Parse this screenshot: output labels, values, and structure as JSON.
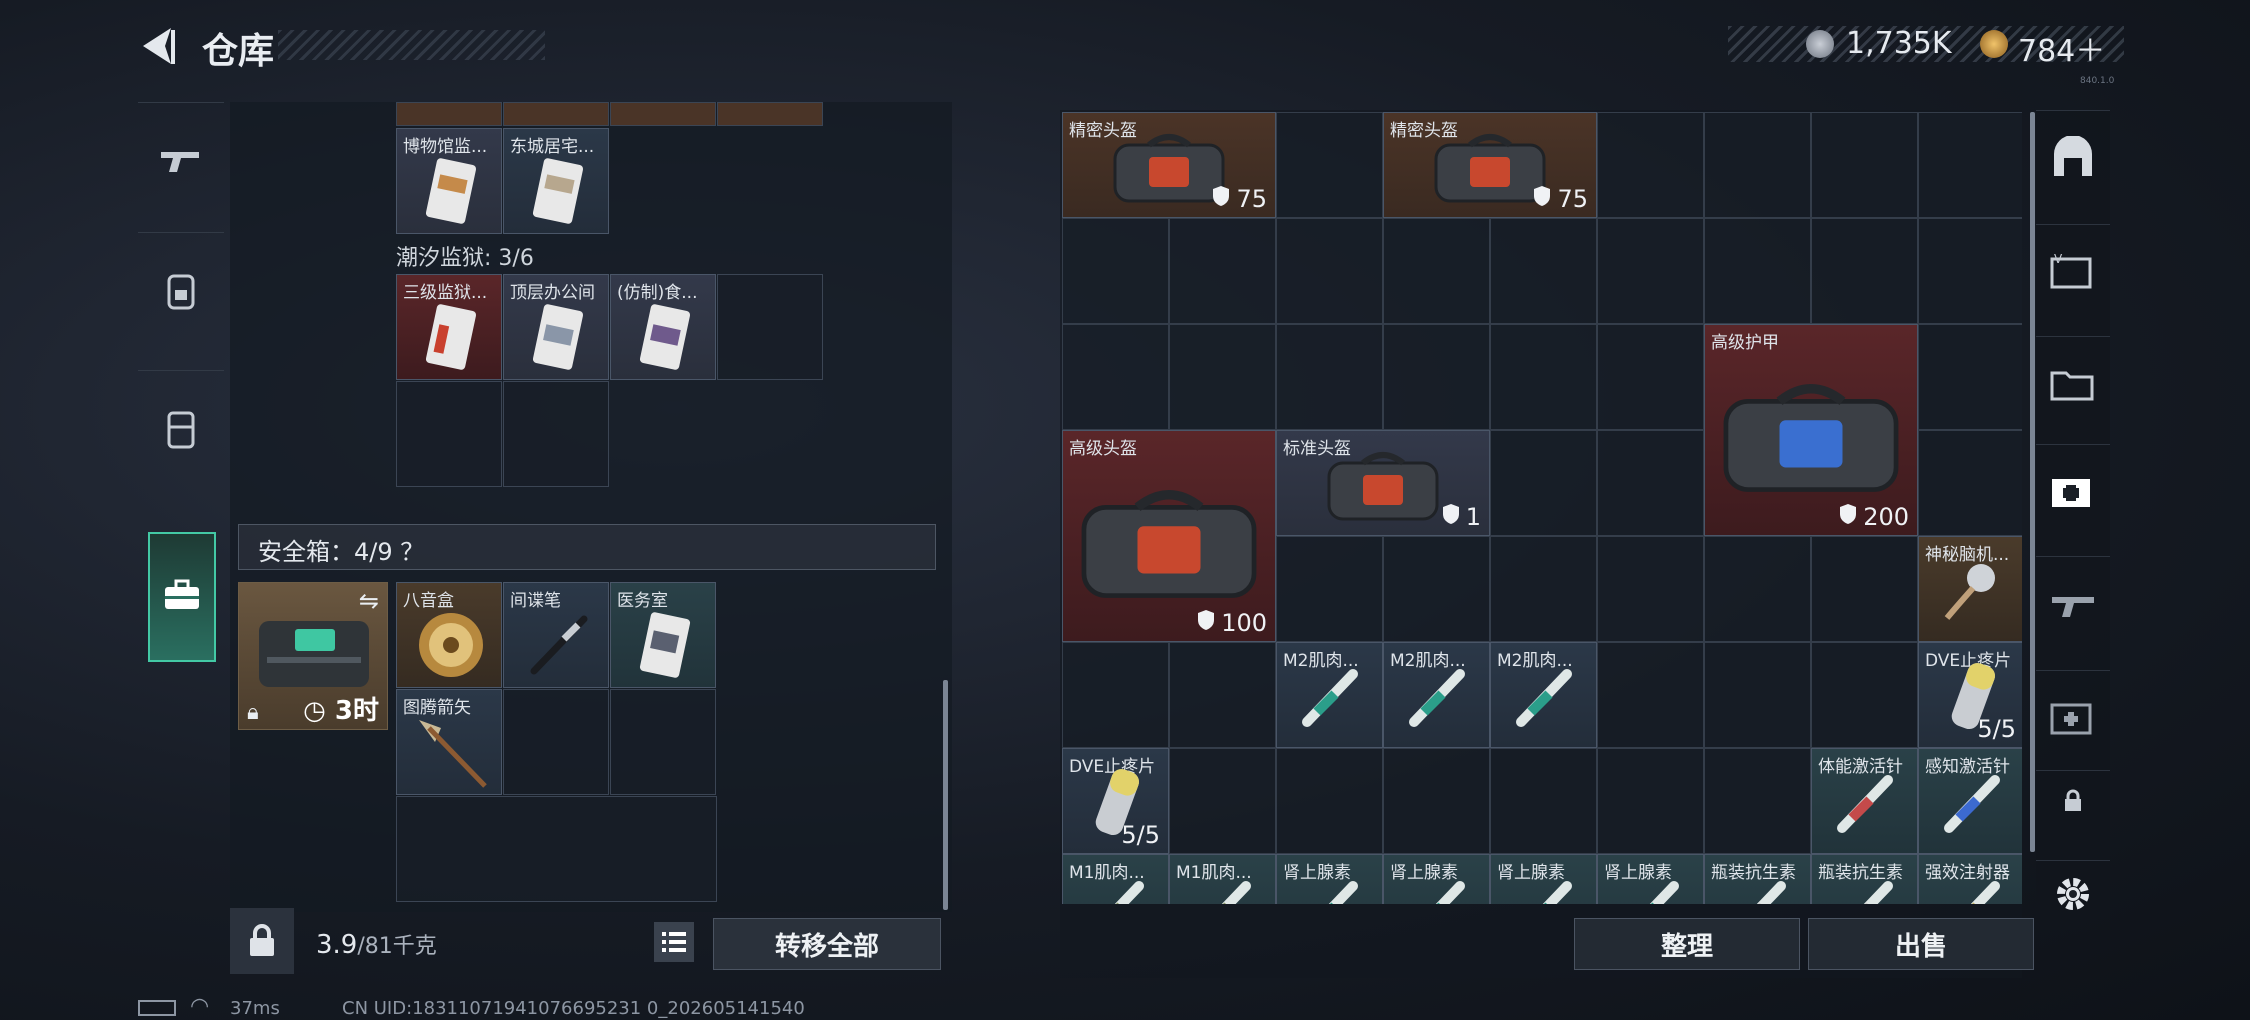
{
  "header": {
    "title": "仓库",
    "currency_silver": "1,735K",
    "currency_gold": "784＋",
    "version": "840.1.0"
  },
  "left_sidebar": [
    "gun-icon",
    "backpack-icon",
    "vest-icon",
    "briefcase-icon"
  ],
  "left": {
    "top_items": [
      {
        "label": "博物馆监...",
        "rarity": "grey"
      },
      {
        "label": "东城居宅...",
        "rarity": "blue"
      }
    ],
    "prison_label": "潮汐监狱: 3/6",
    "prison_items": [
      {
        "label": "三级监狱...",
        "rarity": "red"
      },
      {
        "label": "顶层办公间",
        "rarity": "grey"
      },
      {
        "label": "(仿制)食...",
        "rarity": "grey"
      }
    ],
    "safe_label": "安全箱：4/9 ？",
    "safe_box_timer": "3时",
    "safe_items": [
      {
        "label": "八音盒",
        "rarity": "gold"
      },
      {
        "label": "间谍笔",
        "rarity": "blue"
      },
      {
        "label": "医务室",
        "rarity": "teal"
      },
      {
        "label": "图腾箭矢",
        "rarity": "blue"
      }
    ],
    "weight_current": "3.9",
    "weight_max": "/81千克",
    "transfer_all": "转移全部"
  },
  "right": {
    "items": [
      {
        "label": "精密头盔",
        "value": "75"
      },
      {
        "label": "精密头盔",
        "value": "75"
      },
      {
        "label": "高级护甲",
        "value": "200"
      },
      {
        "label": "高级头盔",
        "value": "100"
      },
      {
        "label": "标准头盔",
        "value": "1"
      },
      {
        "label": "神秘脑机...",
        "value": ""
      },
      {
        "label": "M2肌肉...",
        "value": ""
      },
      {
        "label": "M2肌肉...",
        "value": ""
      },
      {
        "label": "M2肌肉...",
        "value": ""
      },
      {
        "label": "DVE止疼片",
        "value": "5/5"
      },
      {
        "label": "DVE止疼片",
        "value": "5/5"
      },
      {
        "label": "体能激活针",
        "value": ""
      },
      {
        "label": "感知激活针",
        "value": ""
      },
      {
        "label": "M1肌肉...",
        "value": ""
      },
      {
        "label": "M1肌肉...",
        "value": ""
      },
      {
        "label": "肾上腺素",
        "value": ""
      },
      {
        "label": "肾上腺素",
        "value": ""
      },
      {
        "label": "肾上腺素",
        "value": ""
      },
      {
        "label": "肾上腺素",
        "value": ""
      },
      {
        "label": "瓶装抗生素",
        "value": ""
      },
      {
        "label": "瓶装抗生素",
        "value": ""
      },
      {
        "label": "强效注射器",
        "value": ""
      }
    ],
    "tidy": "整理",
    "sell": "出售"
  },
  "right_sidebar": [
    "shelter-icon",
    "card-v-icon",
    "folder-iv-icon",
    "medkit-iv-icon",
    "gun-iii-icon",
    "medkit-ii-icon",
    "lock-icon",
    "settings-icon"
  ],
  "status": {
    "ping": "37ms",
    "uid": "CN UID:18311071941076695231 0_202605141540"
  }
}
